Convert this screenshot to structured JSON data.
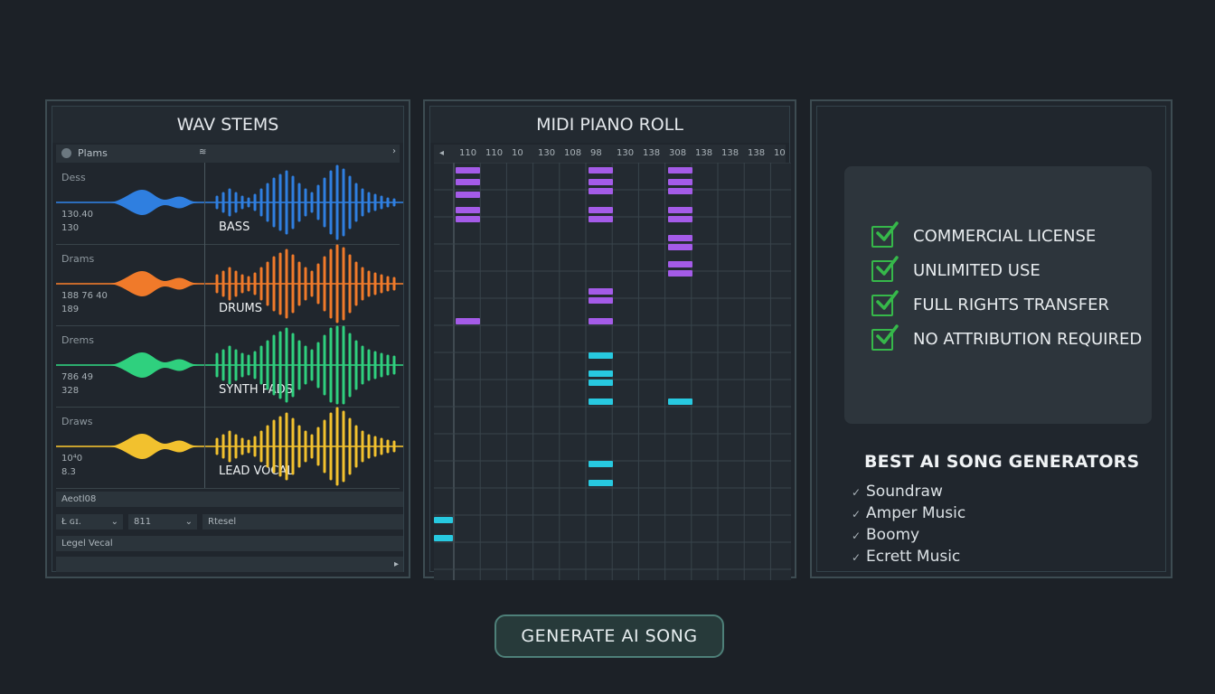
{
  "wav_panel": {
    "title": "WAV STEMS",
    "header_label": "Plams",
    "header_marker": "≋",
    "header_arrow": "›",
    "stems": [
      {
        "name": "Dess",
        "n1": "130.40",
        "n2": "130",
        "label": "BASS",
        "color": "#2f7fe0"
      },
      {
        "name": "Drams",
        "n1": "188 76 40",
        "n2": "189",
        "label": "DRUMS",
        "color": "#f07a2a"
      },
      {
        "name": "Drems",
        "n1": "786 49",
        "n2": "328",
        "label": "SYNTH PADS",
        "color": "#2fd07e"
      },
      {
        "name": "Draws",
        "n1": "10⁴0",
        "n2": "8.3",
        "label": "LEAD VOCAL",
        "color": "#f2c12e"
      }
    ],
    "controls": {
      "field1": "Aeotl08",
      "select1": "Ł ɢɪ.",
      "select2": "811",
      "field2": "Rtesel",
      "field3": "Legel Vecal",
      "chevron": "⌄",
      "scroll_arrow": "▸"
    }
  },
  "midi_panel": {
    "title": "MIDI PIANO ROLL",
    "ruler_marker": "◂",
    "ruler": [
      "110",
      "110",
      "10",
      "130",
      "108",
      "98",
      "130",
      "138",
      "308",
      "138",
      "138",
      "138",
      "10"
    ]
  },
  "features_panel": {
    "features": [
      "COMMERCIAL LICENSE",
      "UNLIMITED USE",
      "FULL RIGHTS TRANSFER",
      "NO ATTRIBUTION REQUIRED"
    ],
    "generators_title": "BEST AI SONG GENERATORS",
    "check_glyph": "✓",
    "generators": [
      "Soundraw",
      "Amper Music",
      "Boomy",
      "Ecrett Music"
    ]
  },
  "generate_button": "GENERATE AI SONG",
  "colors": {
    "purple": "#a45be8",
    "cyan": "#27c9e0",
    "check_green": "#36b84a"
  }
}
